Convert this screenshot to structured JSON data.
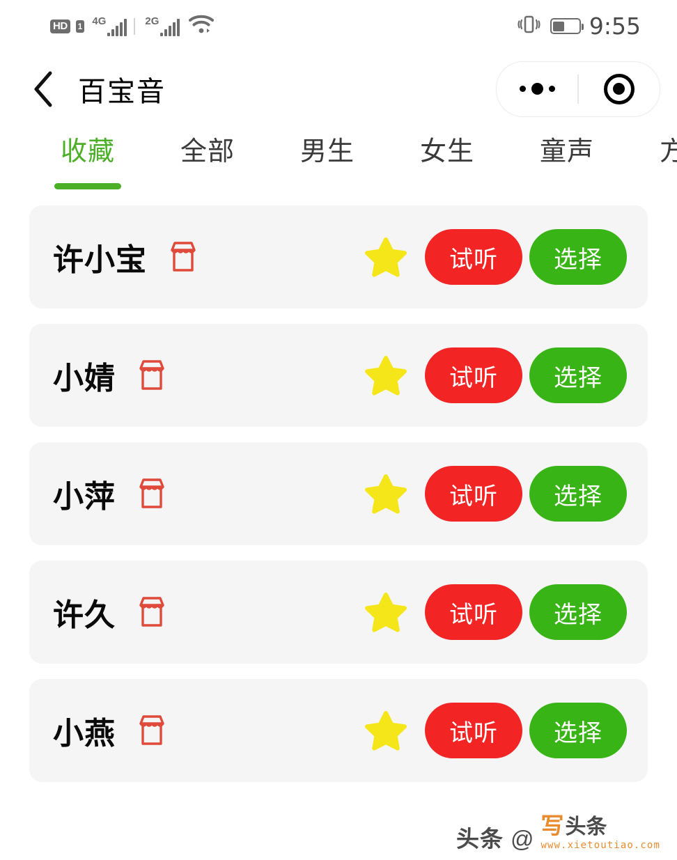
{
  "status_bar": {
    "hd_label": "HD",
    "sim_label": "1",
    "network_1": "4G",
    "network_2": "2G",
    "wifi_icon": "wifi-icon",
    "vibrate_icon": "vibrate-icon",
    "battery_icon": "battery-icon",
    "battery_percent": 45,
    "time": "9:55"
  },
  "nav": {
    "back_icon": "back-chevron-icon",
    "title": "百宝音",
    "capsule": {
      "menu_icon": "more-dots-icon",
      "close_icon": "target-circle-icon"
    }
  },
  "tabs": {
    "active_index": 0,
    "items": [
      {
        "label": "收藏"
      },
      {
        "label": "全部"
      },
      {
        "label": "男生"
      },
      {
        "label": "女生"
      },
      {
        "label": "童声"
      },
      {
        "label": "方言"
      }
    ]
  },
  "list": {
    "shop_icon": "shop-icon",
    "star_icon": "star-icon",
    "listen_label": "试听",
    "select_label": "选择",
    "rows": [
      {
        "name": "许小宝",
        "starred": true
      },
      {
        "name": "小婧",
        "starred": true
      },
      {
        "name": "小萍",
        "starred": true
      },
      {
        "name": "许久",
        "starred": true
      },
      {
        "name": "小燕",
        "starred": true
      }
    ]
  },
  "watermark": {
    "toutiao": "头条",
    "at": "@",
    "xie": "写",
    "toutiao2": "头条",
    "url": "www.xietoutiao.com"
  },
  "colors": {
    "accent_green": "#4caf28",
    "button_red": "#f22424",
    "button_green": "#39b416",
    "shop_red": "#e04a3a",
    "star_yellow": "#f5e61a",
    "card_bg": "#f5f5f5",
    "watermark_orange": "#e8821e"
  }
}
